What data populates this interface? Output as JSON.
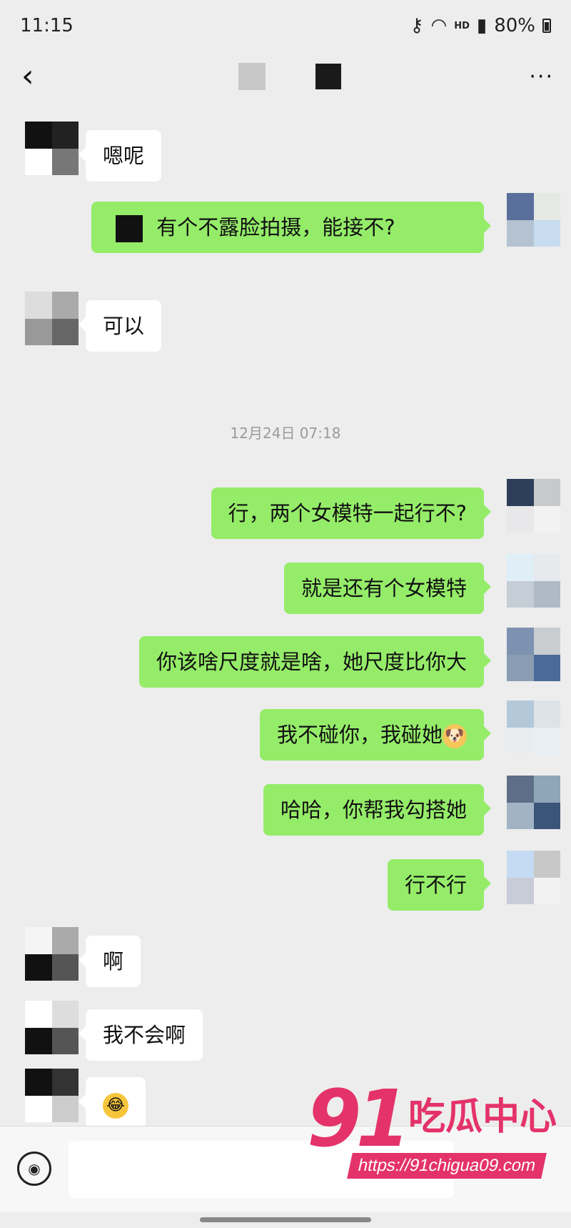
{
  "status_bar": {
    "time": "11:15",
    "network": "HD",
    "battery": "80%"
  },
  "nav": {
    "back_label": "<",
    "more_label": "···"
  },
  "timestamp": "12月24日 07:18",
  "messages": [
    {
      "side": "in",
      "text": "嗯呢"
    },
    {
      "side": "out",
      "text_before": "",
      "text_after": "有个不露脸拍摄，能接不?"
    },
    {
      "side": "in",
      "text": "可以"
    },
    {
      "side": "out",
      "text": "行，两个女模特一起行不?"
    },
    {
      "side": "out",
      "text": "就是还有个女模特"
    },
    {
      "side": "out",
      "text": "你该啥尺度就是啥，她尺度比你大"
    },
    {
      "side": "out",
      "text": "我不碰你，我碰她",
      "emoji": "dog-emoji"
    },
    {
      "side": "out",
      "text": "哈哈，你帮我勾搭她"
    },
    {
      "side": "out",
      "text": "行不行"
    },
    {
      "side": "in",
      "text": "啊"
    },
    {
      "side": "in",
      "text": "我不会啊"
    },
    {
      "side": "in",
      "text": "",
      "emoji": "laugh-cry-emoji"
    }
  ],
  "watermark": {
    "number": "91",
    "name": "吃瓜中心",
    "url": "https://91chigua09.com"
  },
  "colors": {
    "outgoing_bubble": "#95ec69",
    "incoming_bubble": "#ffffff",
    "background": "#ededed",
    "watermark": "#e4326a"
  }
}
